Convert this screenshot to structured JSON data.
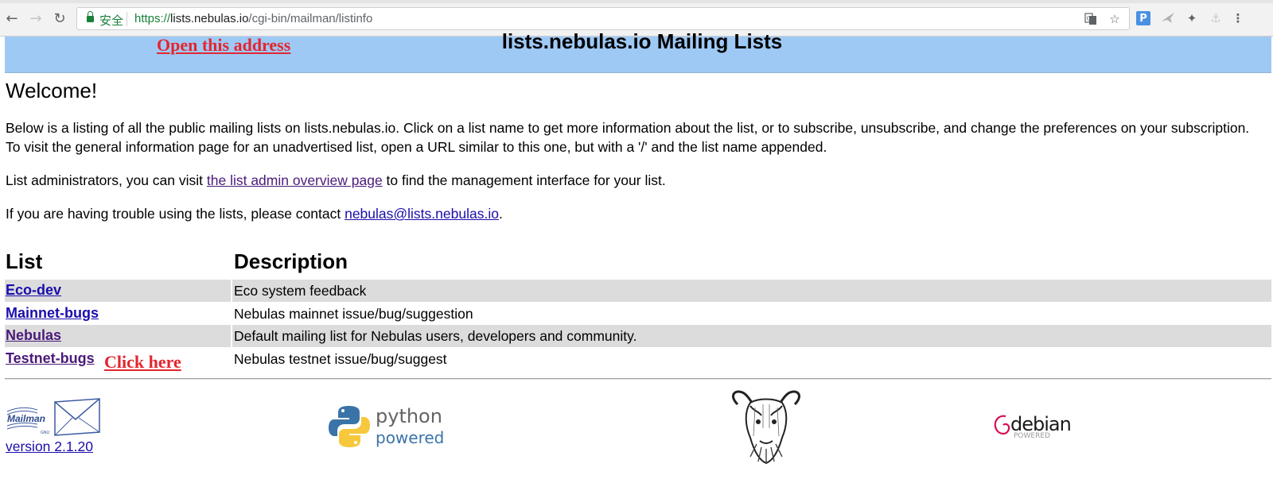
{
  "browser": {
    "secure_label": "安全",
    "url_scheme": "https://",
    "url_host": "lists.nebulas.io",
    "url_path": "/cgi-bin/mailman/listinfo",
    "icons": [
      "back-icon",
      "forward-icon",
      "reload-icon",
      "lock-icon",
      "translate-icon",
      "bookmark-star-icon",
      "extension-p-icon",
      "extension-bird-icon",
      "extension-compass-icon",
      "extension-puzzle-icon",
      "menu-icon"
    ],
    "ext_p_label": "P"
  },
  "banner": {
    "title": "lists.nebulas.io Mailing Lists"
  },
  "annotations": {
    "open_address": "Open this address",
    "click_here": "Click here",
    "color": "#e3262f"
  },
  "content": {
    "welcome": "Welcome!",
    "intro": "Below is a listing of all the public mailing lists on lists.nebulas.io. Click on a list name to get more information about the list, or to subscribe, unsubscribe, and change the preferences on your subscription. To visit the general information page for an unadvertised list, open a URL similar to this one, but with a '/' and the list name appended.",
    "admin_prefix": "List administrators, you can visit ",
    "admin_link": "the list admin overview page",
    "admin_suffix": " to find the management interface for your list.",
    "contact_prefix": "If you are having trouble using the lists, please contact ",
    "contact_link": "nebulas@lists.nebulas.io",
    "contact_suffix": "."
  },
  "table": {
    "headers": [
      "List",
      "Description"
    ],
    "rows": [
      {
        "name": "Eco-dev",
        "description": "Eco system feedback"
      },
      {
        "name": "Mainnet-bugs",
        "description": "Nebulas mainnet issue/bug/suggestion"
      },
      {
        "name": "Nebulas",
        "description": "Default mailing list for Nebulas users, developers and community."
      },
      {
        "name": "Testnet-bugs",
        "description": "Nebulas testnet issue/bug/suggest"
      }
    ]
  },
  "footer": {
    "mailman_text": "Mailman",
    "mailman_sub": "GNU",
    "version": "version 2.1.20",
    "python_line1": "python",
    "python_line2": "powered",
    "debian_text": "debian",
    "debian_sub": "POWERED"
  },
  "colors": {
    "banner_bg": "#9fc9f5",
    "row_shade": "#dcdcdc",
    "link": "#1a0dab",
    "visited": "#4b1a7a"
  }
}
